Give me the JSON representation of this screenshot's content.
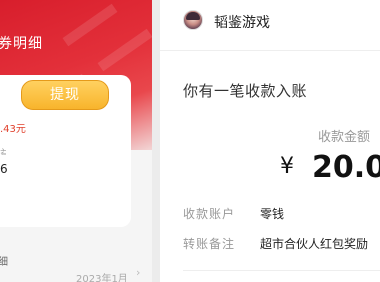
{
  "left_panel": {
    "header_title": "券明细",
    "withdraw_button": "提现",
    "amount_partial": ".43元",
    "field_label_partial": "益",
    "field_value_partial": "6",
    "detail_label": "细",
    "date_partial": "2023年1月",
    "chevron": "›"
  },
  "right_panel": {
    "app_name": "韬鉴游戏",
    "notice": "你有一笔收款入账",
    "amount_label": "收款金额",
    "currency_symbol": "¥",
    "amount_value": "20.0",
    "rows": [
      {
        "label": "收款账户",
        "value": "零钱"
      },
      {
        "label": "转账备注",
        "value": "超市合伙人红包奖励"
      }
    ]
  },
  "colors": {
    "header_red": "#d81e2c",
    "button_gold": "#f8b42c",
    "amount_red": "#e0402c"
  }
}
